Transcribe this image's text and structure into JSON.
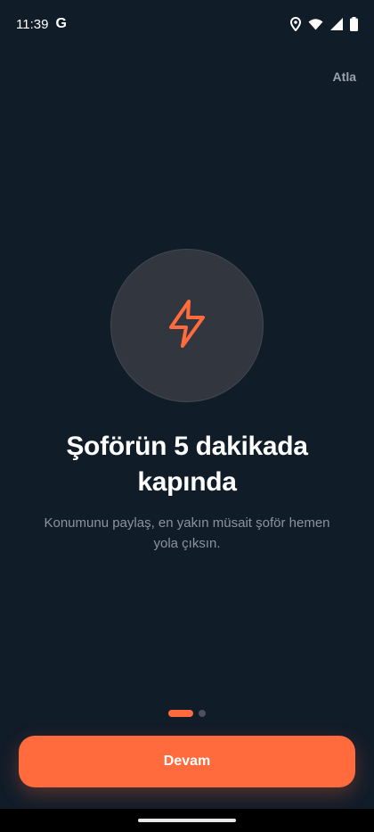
{
  "status_bar": {
    "time": "11:39",
    "google_letter": "G",
    "icons": [
      "location-icon",
      "wifi-icon",
      "signal-icon",
      "battery-icon"
    ]
  },
  "header": {
    "skip_label": "Atla"
  },
  "hero": {
    "icon": "lightning-bolt-icon",
    "accent_color": "#ff6b3d"
  },
  "onboarding": {
    "title_line1": "Şoförün 5 dakikada",
    "title_line2": "kapında",
    "subtitle_line1": "Konumunu paylaş, en yakın müsait şoför hemen",
    "subtitle_line2": "yola çıksın.",
    "page_index": 1,
    "page_count": 2
  },
  "actions": {
    "continue_label": "Devam"
  },
  "colors": {
    "background": "#111c29",
    "accent": "#ff6b3d",
    "circle": "#32363e"
  }
}
